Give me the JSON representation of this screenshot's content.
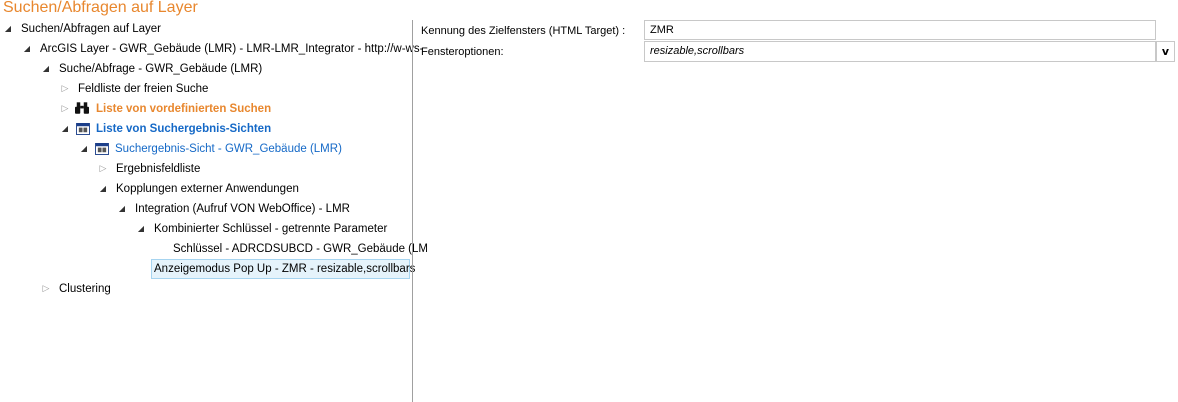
{
  "title": "Suchen/Abfragen auf Layer",
  "tree": [
    {
      "label": "Suchen/Abfragen auf Layer",
      "state": "open"
    },
    {
      "label": "ArcGIS Layer - GWR_Gebäude (LMR) - LMR-LMR_Integrator - http://w-ws-",
      "state": "open"
    },
    {
      "label": "Suche/Abfrage - GWR_Gebäude (LMR)",
      "state": "open"
    },
    {
      "label": "Feldliste der freien Suche",
      "state": "closed"
    },
    {
      "label": "Liste von vordefinierten Suchen",
      "state": "closed",
      "icon": "binoculars-icon"
    },
    {
      "label": "Liste von Suchergebnis-Sichten",
      "state": "open",
      "icon": "table-view-icon"
    },
    {
      "label": "Suchergebnis-Sicht - GWR_Gebäude (LMR)",
      "state": "open",
      "icon": "table-view-icon"
    },
    {
      "label": "Ergebnisfeldliste",
      "state": "closed"
    },
    {
      "label": "Kopplungen externer Anwendungen",
      "state": "open"
    },
    {
      "label": "Integration (Aufruf VON WebOffice) - LMR",
      "state": "open"
    },
    {
      "label": "Kombinierter Schlüssel - getrennte Parameter",
      "state": "open"
    },
    {
      "label": "Schlüssel - ADRCDSUBCD - GWR_Gebäude (LM",
      "state": "leaf"
    },
    {
      "label": "Anzeigemodus Pop Up - ZMR - resizable,scrollbars",
      "state": "leaf",
      "selected": true
    },
    {
      "label": "Clustering",
      "state": "closed"
    }
  ],
  "form": {
    "target_label": "Kennung des Zielfensters (HTML Target) :",
    "target_value": "ZMR",
    "options_label": "Fensteroptionen:",
    "options_value": "resizable,scrollbars",
    "dropdown_glyph": "v"
  },
  "colors": {
    "accent": "#e8872e",
    "link": "#1569c7"
  }
}
